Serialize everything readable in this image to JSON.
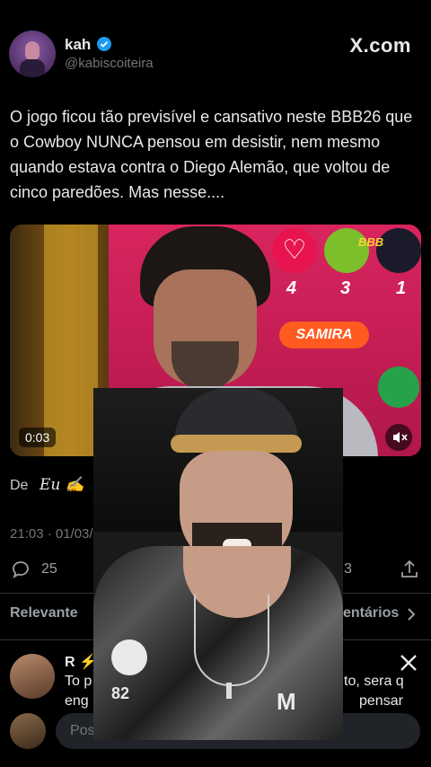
{
  "header": {
    "display_name": "kah",
    "handle": "@kabiscoiteira",
    "brand": "X.com"
  },
  "tweet": {
    "text": "O jogo ficou tão previsível e cansativo neste BBB26 que o Cowboy NUNCA pensou em desistir, nem mesmo quando estava contra o Diego Alemão, que voltou de cinco paredões. Mas nesse....",
    "video_time": "0:03",
    "video_scores": [
      "4",
      "3",
      "1"
    ],
    "video_logo": "BBB",
    "video_name_plate": "SAMIRA",
    "from_label": "De",
    "from_name": "Eu ✍️",
    "timestamp": "21:03 · 01/03/2026 · 13.3",
    "reply_count": "25",
    "right_count": "3",
    "sort_label": "Relevante",
    "comments_label": "entários"
  },
  "reply": {
    "name": "R ⚡",
    "line1_left": "To p",
    "line1_right": "to, sera q",
    "line2_left": "eng",
    "line2_right": "pensar"
  },
  "composer": {
    "placeholder": "Post"
  },
  "overlay": {
    "shirt_text": "82",
    "shirt_logo": "M"
  }
}
